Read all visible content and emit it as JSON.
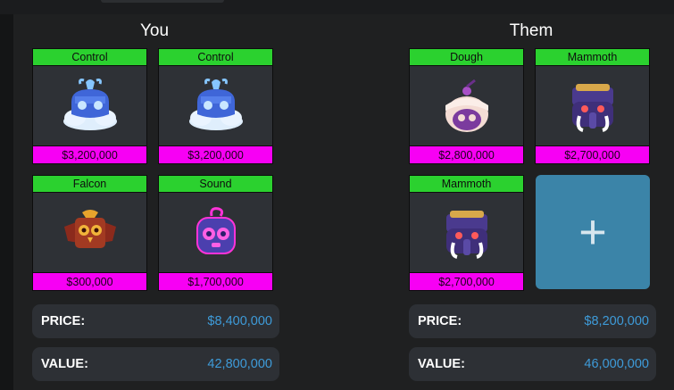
{
  "you": {
    "title": "You",
    "items": [
      {
        "name": "Control",
        "price": "$3,200,000",
        "icon": "control-fruit-icon"
      },
      {
        "name": "Control",
        "price": "$3,200,000",
        "icon": "control-fruit-icon"
      },
      {
        "name": "Falcon",
        "price": "$300,000",
        "icon": "falcon-fruit-icon"
      },
      {
        "name": "Sound",
        "price": "$1,700,000",
        "icon": "sound-fruit-icon"
      }
    ],
    "price_label": "PRICE:",
    "price_value": "$8,400,000",
    "value_label": "VALUE:",
    "value_value": "42,800,000"
  },
  "them": {
    "title": "Them",
    "items": [
      {
        "name": "Dough",
        "price": "$2,800,000",
        "icon": "dough-fruit-icon"
      },
      {
        "name": "Mammoth",
        "price": "$2,700,000",
        "icon": "mammoth-fruit-icon"
      },
      {
        "name": "Mammoth",
        "price": "$2,700,000",
        "icon": "mammoth-fruit-icon"
      }
    ],
    "add_label": "+",
    "price_label": "PRICE:",
    "price_value": "$8,200,000",
    "value_label": "VALUE:",
    "value_value": "46,000,000"
  },
  "colors": {
    "name_bar": "#2bd12f",
    "price_bar": "#f700f4",
    "stat_value": "#3e9bd9",
    "add_button": "#3b84a8"
  }
}
